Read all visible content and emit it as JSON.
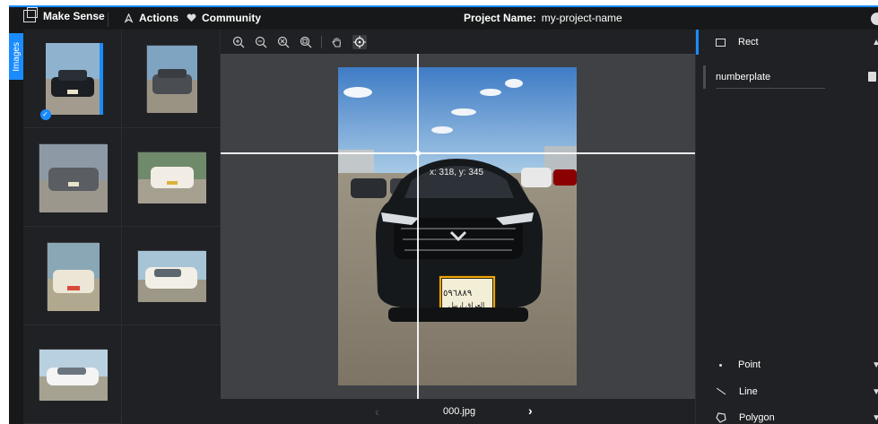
{
  "topbar": {
    "brand": "Make Sense",
    "actions": "Actions",
    "community": "Community",
    "project_label": "Project Name:",
    "project_name": "my-project-name"
  },
  "sidebar": {
    "tab_label": "Images"
  },
  "toolbar": {
    "tools": [
      "zoom-in-icon",
      "zoom-out-icon",
      "zoom-fit-icon",
      "zoom-max-icon",
      "hand-icon",
      "crosshair-icon"
    ]
  },
  "canvas": {
    "coords": "x: 318, y: 345"
  },
  "nav": {
    "filename": "000.jpg",
    "prev": "‹",
    "next": "›"
  },
  "right_panel": {
    "rect": {
      "label": "Rect"
    },
    "labels": [
      {
        "name": "numberplate"
      }
    ],
    "point": {
      "label": "Point"
    },
    "line": {
      "label": "Line"
    },
    "polygon": {
      "label": "Polygon"
    }
  },
  "thumbnails": [
    {
      "id": "thumb-1",
      "selected": true
    },
    {
      "id": "thumb-2",
      "selected": false
    },
    {
      "id": "thumb-3",
      "selected": false
    },
    {
      "id": "thumb-4",
      "selected": false
    },
    {
      "id": "thumb-5",
      "selected": false
    },
    {
      "id": "thumb-6",
      "selected": false
    },
    {
      "id": "thumb-7",
      "selected": false
    }
  ],
  "colors": {
    "accent": "#1a8cff",
    "background": "#1f2124",
    "canvas": "#3f4145",
    "bbox": "#f0a500"
  }
}
